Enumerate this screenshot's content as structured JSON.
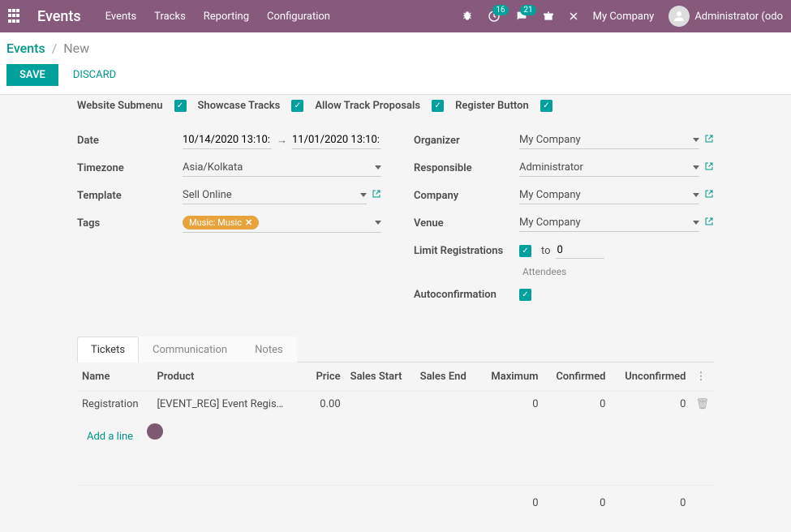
{
  "topbar": {
    "brand": "Events",
    "menu": [
      "Events",
      "Tracks",
      "Reporting",
      "Configuration"
    ],
    "badge_clock": "16",
    "badge_chat": "21",
    "company": "My Company",
    "user": "Administrator (odo"
  },
  "breadcrumb": {
    "root": "Events",
    "current": "New"
  },
  "actions": {
    "save": "SAVE",
    "discard": "DISCARD"
  },
  "checks": {
    "website_submenu": "Website Submenu",
    "showcase_tracks": "Showcase Tracks",
    "allow_proposals": "Allow Track Proposals",
    "register_button": "Register Button"
  },
  "left_fields": {
    "date_label": "Date",
    "date_start": "10/14/2020 13:10:",
    "date_end": "11/01/2020 13:10:",
    "timezone_label": "Timezone",
    "timezone_value": "Asia/Kolkata",
    "template_label": "Template",
    "template_value": "Sell Online",
    "tags_label": "Tags",
    "tag_value": "Music: Music"
  },
  "right_fields": {
    "organizer_label": "Organizer",
    "organizer_value": "My Company",
    "responsible_label": "Responsible",
    "responsible_value": "Administrator",
    "company_label": "Company",
    "company_value": "My Company",
    "venue_label": "Venue",
    "venue_value": "My Company",
    "limit_label": "Limit Registrations",
    "limit_to": "to",
    "limit_value": "0",
    "attendees_hint": "Attendees",
    "autoconf_label": "Autoconfirmation"
  },
  "tabs": {
    "tickets": "Tickets",
    "communication": "Communication",
    "notes": "Notes"
  },
  "table": {
    "headers": {
      "name": "Name",
      "product": "Product",
      "price": "Price",
      "sales_start": "Sales Start",
      "sales_end": "Sales End",
      "maximum": "Maximum",
      "confirmed": "Confirmed",
      "unconfirmed": "Unconfirmed"
    },
    "rows": [
      {
        "name": "Registration",
        "product": "[EVENT_REG] Event Regis…",
        "price": "0.00",
        "sales_start": "",
        "sales_end": "",
        "maximum": "0",
        "confirmed": "0",
        "unconfirmed": "0"
      }
    ],
    "add_line": "Add a line",
    "totals": {
      "maximum": "0",
      "confirmed": "0",
      "unconfirmed": "0"
    }
  }
}
